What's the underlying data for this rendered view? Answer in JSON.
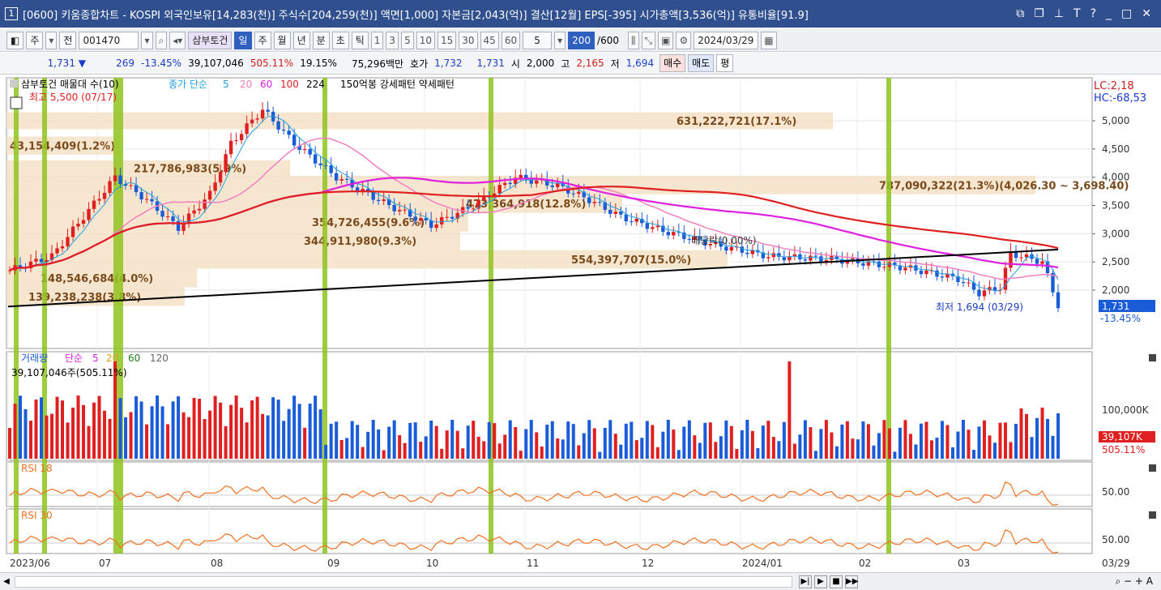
{
  "titlebar": {
    "number": "1",
    "title": "[0600] 키움종합차트 - KOSPI 외국인보유[14,283(천)] 주식수[204,259(천)] 액면[1,000] 자본금[2,043(억)] 결산[12월] EPS[-395] 시가총액[3,536(억)] 유통비율[91.9]"
  },
  "toolbar": {
    "market": "주",
    "prev": "전",
    "code": "001470",
    "name": "삼부토건",
    "periods": [
      "일",
      "주",
      "월",
      "년",
      "분",
      "초",
      "틱"
    ],
    "period_selected": "일",
    "intervals": [
      "1",
      "3",
      "5",
      "10",
      "15",
      "30",
      "45",
      "60"
    ],
    "interval_value": "5",
    "count": "200",
    "count_total": "/600",
    "date": "2024/03/29"
  },
  "info": {
    "price": "1,731 ▼",
    "change": "269",
    "change_pct": "-13.45%",
    "volume": "39,107,046",
    "volume_ratio": "505.11%",
    "turnover": "19.15%",
    "amount": "75,296백만",
    "quote_label": "호가",
    "quote_ask": "1,732",
    "quote_bid": "1,731",
    "open_label": "시",
    "open": "2,000",
    "high_label": "고",
    "high": "2,165",
    "low_label": "저",
    "low": "1,694",
    "buy": "매수",
    "sell": "매도",
    "eval": "평"
  },
  "legend": {
    "main": "삼부토건 매물대 수(10)",
    "ma_label": "종가 단순",
    "ma_periods": [
      "5",
      "20",
      "60",
      "100",
      "224"
    ],
    "pattern": "150억봉 강세패턴  약세패턴",
    "vol": "거래량",
    "vol_ma": "단순",
    "vol_periods": [
      "5",
      "20",
      "60",
      "120"
    ],
    "vol_value": "39,107,046주(505.11%)",
    "rsi1": "RSI 18",
    "rsi2": "RSI 30"
  },
  "annotations": {
    "high": "최고 5,500 (07/17)",
    "low": "최저 1,694 (03/29)",
    "dividend": "배당락(0.00%)",
    "lc": "LC:2,18",
    "hc": "HC:-68,53",
    "last_price": "1,731",
    "last_pct": "-13.45%",
    "vol_last": "39,107K",
    "vol_pct": "505.11%",
    "rsi_level": "50.00"
  },
  "price_axis": [
    "5,000",
    "4,500",
    "4,000",
    "3,500",
    "3,000",
    "2,500",
    "2,000"
  ],
  "vol_axis": "100,000K",
  "date_axis": [
    "2023/06",
    "07",
    "08",
    "09",
    "10",
    "11",
    "12",
    "2024/01",
    "02",
    "03",
    "03/29"
  ],
  "volume_profile": [
    {
      "label": "631,222,721(17.1%)",
      "price_lo": 4850,
      "price_hi": 5150
    },
    {
      "label": "787,090,322(21.3%)(4,026.30 ~ 3,698.40)",
      "price_lo": 3698,
      "price_hi": 4026
    },
    {
      "label": "473,364,918(12.8%)",
      "price_lo": 3370,
      "price_hi": 3698
    },
    {
      "label": "354,726,455(9.6%)",
      "price_lo": 3040,
      "price_hi": 3370
    },
    {
      "label": "344,911,980(9.3%)",
      "price_lo": 2710,
      "price_hi": 3040
    },
    {
      "label": "554,397,707(15.0%)",
      "price_lo": 2380,
      "price_hi": 2710
    },
    {
      "label": "148,546,684(4.0%)",
      "price_lo": 2050,
      "price_hi": 2380
    },
    {
      "label": "139,238,238(3.8%)",
      "price_lo": 1720,
      "price_hi": 2050
    },
    {
      "label": "43,154,409(1.2%)",
      "price_lo": 4400,
      "price_hi": 4720
    },
    {
      "label": "217,786,983(5.9%)",
      "price_lo": 4020,
      "price_hi": 4300
    }
  ],
  "colors": {
    "up": "#e02020",
    "down": "#1a5cd8",
    "ma5": "#20a0e0",
    "ma20": "#f080c0",
    "ma60": "#e020e0",
    "ma100": "#e02020",
    "ma224": "#000000",
    "profile": "#f5e2c8",
    "pattern_bar": "#8fc31f",
    "rsi": "#f07020",
    "title_bg": "#2f4f8e"
  }
}
